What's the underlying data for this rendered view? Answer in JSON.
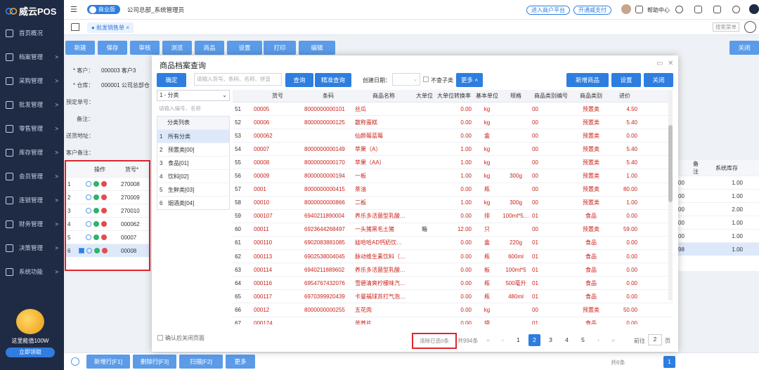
{
  "brand": {
    "name": "威云POS"
  },
  "sidebar": {
    "items": [
      {
        "label": "首页概况",
        "arrow": ""
      },
      {
        "label": "档案管理",
        "arrow": ">"
      },
      {
        "label": "采购管理",
        "arrow": ">"
      },
      {
        "label": "批发管理",
        "arrow": ">"
      },
      {
        "label": "零售管理",
        "arrow": ">"
      },
      {
        "label": "库存管理",
        "arrow": ">"
      },
      {
        "label": "会员管理",
        "arrow": ">"
      },
      {
        "label": "连锁管理",
        "arrow": ">"
      },
      {
        "label": "财务管理",
        "arrow": ">"
      },
      {
        "label": "决策管理",
        "arrow": ">"
      },
      {
        "label": "系统功能",
        "arrow": ">"
      }
    ],
    "promo": {
      "text": "这里能值100W",
      "button": "立即领取"
    }
  },
  "topbar": {
    "edition": "商业版",
    "title": "公司总部_系统管理员",
    "links": [
      "进入商户平台",
      "开通威支付"
    ],
    "help": "帮助中心"
  },
  "tabs": {
    "active": "批发销售单",
    "search_menu": "搜索菜单"
  },
  "toolbar": {
    "buttons": [
      "新建",
      "保存",
      "审核",
      "浏览",
      "商品",
      "设置",
      "打印",
      "编辑"
    ],
    "close": "关闭"
  },
  "form": {
    "customer_label": "* 客户：",
    "customer_value": "000003  客户3",
    "warehouse_label": "* 仓库：",
    "warehouse_value": "000001  公司总部仓",
    "presale_label": "预定单号：",
    "remark_label": "备注：",
    "address_label": "送货地址：",
    "customer_remark_label": "客户备注："
  },
  "left_grid": {
    "headers": [
      "操作",
      "货号*"
    ],
    "rows": [
      {
        "n": "1",
        "code": "270008"
      },
      {
        "n": "2",
        "code": "270009"
      },
      {
        "n": "3",
        "code": "270010"
      },
      {
        "n": "4",
        "code": "000062"
      },
      {
        "n": "5",
        "code": "00007"
      },
      {
        "n": "6",
        "code": "00008"
      }
    ]
  },
  "right_grid": {
    "headers": [
      "备注",
      "系统库存"
    ],
    "rows": [
      {
        "a": "00",
        "b": "1.00"
      },
      {
        "a": "00",
        "b": "1.00"
      },
      {
        "a": "00",
        "b": "2.00"
      },
      {
        "a": "00",
        "b": "1.00"
      },
      {
        "a": "00",
        "b": "1.00"
      },
      {
        "a": "98",
        "b": "1.00"
      }
    ]
  },
  "bottom": {
    "buttons": [
      "新增行[F1]",
      "删除行[F3]",
      "扫描[F2]",
      "更多"
    ],
    "count": "共6条"
  },
  "modal": {
    "title": "商品档案查询",
    "confirm": "确定",
    "search_placeholder": "请输入货号、条码、名称、拼音",
    "query": "查询",
    "precise": "精准查询",
    "date_label": "创建日期：",
    "no_child": "不查子类",
    "more": "更多",
    "add_product": "新增商品",
    "settings": "设置",
    "close": "关闭",
    "cat_select": "1 - 分类",
    "cat_search": "请输入编号、名称",
    "cat_head": "分类列表",
    "categories": [
      {
        "n": "1",
        "label": "所有分类"
      },
      {
        "n": "2",
        "label": "预置类[00]"
      },
      {
        "n": "3",
        "label": "食品[01]"
      },
      {
        "n": "4",
        "label": "饮料[02]"
      },
      {
        "n": "5",
        "label": "生鲜类[03]"
      },
      {
        "n": "6",
        "label": "烟酒类[04]"
      }
    ],
    "headers": [
      "货号",
      "条码",
      "商品名称",
      "大单位",
      "大单位转换率",
      "基本单位",
      "规格",
      "商品类别编号",
      "商品类别",
      "进价"
    ],
    "rows": [
      [
        "51",
        "00005",
        "8000000000101",
        "丝瓜",
        "",
        "0.00",
        "kg",
        "",
        "00",
        "预置类",
        "4.50"
      ],
      [
        "52",
        "00006",
        "8000000000125",
        "散称蛋糕",
        "",
        "0.00",
        "kg",
        "",
        "00",
        "预置类",
        "5.40"
      ],
      [
        "53",
        "000062",
        "",
        "仙颜莓蓝莓",
        "",
        "0.00",
        "盒",
        "",
        "00",
        "预置类",
        "0.00"
      ],
      [
        "54",
        "00007",
        "8000000000149",
        "苹果（A）",
        "",
        "1.00",
        "kg",
        "",
        "00",
        "预置类",
        "5.40"
      ],
      [
        "55",
        "00008",
        "8000000000170",
        "苹果（AA）",
        "",
        "1.00",
        "kg",
        "",
        "00",
        "预置类",
        "5.40"
      ],
      [
        "56",
        "00009",
        "8000000000194",
        "一板",
        "",
        "1.00",
        "kg",
        "300g",
        "00",
        "预置类",
        "1.00"
      ],
      [
        "57",
        "0001",
        "8000000000415",
        "茶油",
        "",
        "0.00",
        "瓶",
        "",
        "00",
        "预置类",
        "80.00"
      ],
      [
        "58",
        "00010",
        "8000000000866",
        "二板",
        "",
        "1.00",
        "kg",
        "300g",
        "00",
        "预置类",
        "1.00"
      ],
      [
        "59",
        "000107",
        "6940211890004",
        "养乐多活菌型乳酸…",
        "",
        "0.00",
        "排",
        "100ml*5…",
        "01",
        "食品",
        "0.00"
      ],
      [
        "60",
        "00011",
        "6923644268497",
        "一头猪黑毛土猪",
        "箱",
        "12.00",
        "只",
        "",
        "00",
        "预置类",
        "59.00"
      ],
      [
        "61",
        "000110",
        "6902083881085",
        "娃哈哈AD钙奶饮…",
        "",
        "0.00",
        "盒",
        "220g",
        "01",
        "食品",
        "0.00"
      ],
      [
        "62",
        "000113",
        "6902538004045",
        "脉动维生素饮料（…",
        "",
        "0.00",
        "瓶",
        "600ml",
        "01",
        "食品",
        "0.00"
      ],
      [
        "63",
        "000114",
        "6940211889602",
        "养乐多活菌型乳酸…",
        "",
        "0.00",
        "板",
        "100ml*5",
        "01",
        "食品",
        "0.00"
      ],
      [
        "64",
        "000116",
        "6954767432076",
        "雪碧清爽柠檬味汽…",
        "",
        "0.00",
        "瓶",
        "500毫升",
        "01",
        "食品",
        "0.00"
      ],
      [
        "65",
        "000117",
        "6970399920439",
        "卡曼福球苏打气泡…",
        "",
        "0.00",
        "瓶",
        "480ml",
        "01",
        "食品",
        "0.00"
      ],
      [
        "66",
        "00012",
        "8000000000255",
        "五花肉",
        "",
        "0.00",
        "kg",
        "",
        "00",
        "预置类",
        "50.00"
      ],
      [
        "67",
        "000124",
        "",
        "苦荞片",
        "",
        "0.00",
        "袋",
        "",
        "01",
        "食品",
        "0.00"
      ]
    ],
    "footer": {
      "close_after": "确认后关闭页面",
      "cleared": "清除已选0条",
      "total": "共994条",
      "pages": [
        "1",
        "2",
        "3",
        "4",
        "5"
      ],
      "goto_label": "前往",
      "goto_value": "2",
      "page_unit": "页"
    }
  }
}
